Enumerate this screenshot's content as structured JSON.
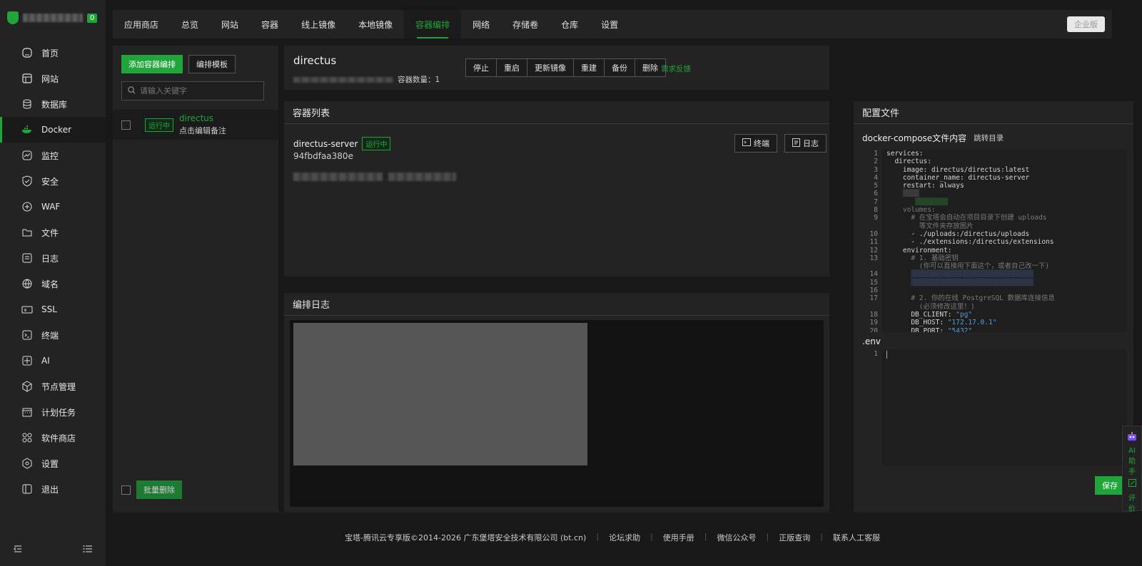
{
  "sidebar": {
    "badge": "0",
    "items": [
      {
        "label": "首页",
        "icon": "home-icon"
      },
      {
        "label": "网站",
        "icon": "website-icon"
      },
      {
        "label": "数据库",
        "icon": "database-icon"
      },
      {
        "label": "Docker",
        "icon": "docker-icon"
      },
      {
        "label": "监控",
        "icon": "monitor-icon"
      },
      {
        "label": "安全",
        "icon": "shield-icon"
      },
      {
        "label": "WAF",
        "icon": "waf-icon"
      },
      {
        "label": "文件",
        "icon": "folder-icon"
      },
      {
        "label": "日志",
        "icon": "log-icon"
      },
      {
        "label": "域名",
        "icon": "globe-icon"
      },
      {
        "label": "SSL",
        "icon": "ssl-icon"
      },
      {
        "label": "终端",
        "icon": "terminal-icon"
      },
      {
        "label": "AI",
        "icon": "ai-icon"
      },
      {
        "label": "节点管理",
        "icon": "node-icon"
      },
      {
        "label": "计划任务",
        "icon": "calendar-icon"
      },
      {
        "label": "软件商店",
        "icon": "store-icon"
      },
      {
        "label": "设置",
        "icon": "settings-icon"
      },
      {
        "label": "退出",
        "icon": "logout-icon"
      }
    ]
  },
  "tabs": [
    "应用商店",
    "总览",
    "网站",
    "容器",
    "线上镜像",
    "本地镜像",
    "容器编排",
    "网络",
    "存储卷",
    "仓库",
    "设置"
  ],
  "enterprise_label": "企业版",
  "left": {
    "add_label": "添加容器编排",
    "template_label": "编排模板",
    "search_placeholder": "请输入关键字",
    "item_status": "运行中",
    "item_name": "directus",
    "item_note": "点击编辑备注",
    "batch_delete": "批量删除"
  },
  "detail": {
    "name": "directus",
    "count_text": "容器数量：1",
    "actions": [
      "停止",
      "重启",
      "更新镜像",
      "重建",
      "备份",
      "删除"
    ],
    "feedback": "需求反馈"
  },
  "container_list": {
    "title": "容器列表",
    "name": "directus-server",
    "status": "运行中",
    "id": "94fbdfaa380e",
    "terminal": "终端",
    "log": "日志"
  },
  "compose_log": {
    "title": "编排日志"
  },
  "config": {
    "title": "配置文件",
    "compose_label": "docker-compose文件内容",
    "jump_label": "跳转目录",
    "env_label": ".env",
    "save_label": "保存",
    "env_line": "1"
  },
  "footer": {
    "copyright": "宝塔-腾讯云专享版©2014-2026 广东堡塔安全技术有限公司 (bt.cn)",
    "links": [
      "论坛求助",
      "使用手册",
      "微信公众号",
      "正版查询",
      "联系人工客服"
    ]
  },
  "ai_float": {
    "label1": "AI",
    "label2": "助",
    "label3": "手",
    "label4": "评",
    "label5": "价"
  },
  "colors": {
    "accent": "#20a53a"
  }
}
